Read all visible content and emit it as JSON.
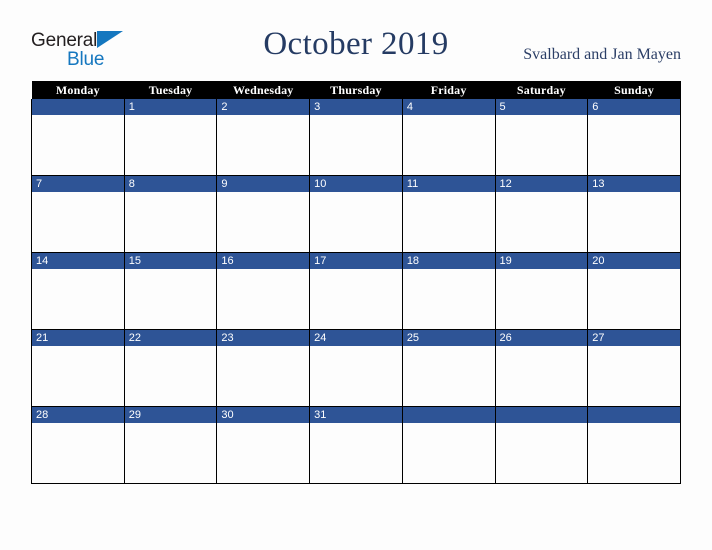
{
  "logo": {
    "word_top": "General",
    "word_bottom": "Blue",
    "triangle_icon": "triangle-icon",
    "color_dark": "#231f20",
    "color_blue": "#1577bf"
  },
  "header": {
    "month_title": "October 2019",
    "country": "Svalbard and Jan Mayen",
    "title_color": "#253b63",
    "country_color": "#2b3e66"
  },
  "calendar": {
    "weekday_headers": [
      "Monday",
      "Tuesday",
      "Wednesday",
      "Thursday",
      "Friday",
      "Saturday",
      "Sunday"
    ],
    "header_bg": "#000000",
    "header_text_color": "#ffffff",
    "day_bar_bg": "#2e5496",
    "day_bar_text_color": "#ffffff",
    "cell_bg": "#fdfdfd",
    "grid_line_color": "#000000",
    "weeks": [
      {
        "days": [
          "",
          "1",
          "2",
          "3",
          "4",
          "5",
          "6"
        ]
      },
      {
        "days": [
          "7",
          "8",
          "9",
          "10",
          "11",
          "12",
          "13"
        ]
      },
      {
        "days": [
          "14",
          "15",
          "16",
          "17",
          "18",
          "19",
          "20"
        ]
      },
      {
        "days": [
          "21",
          "22",
          "23",
          "24",
          "25",
          "26",
          "27"
        ]
      },
      {
        "days": [
          "28",
          "29",
          "30",
          "31",
          "",
          "",
          ""
        ]
      }
    ]
  }
}
